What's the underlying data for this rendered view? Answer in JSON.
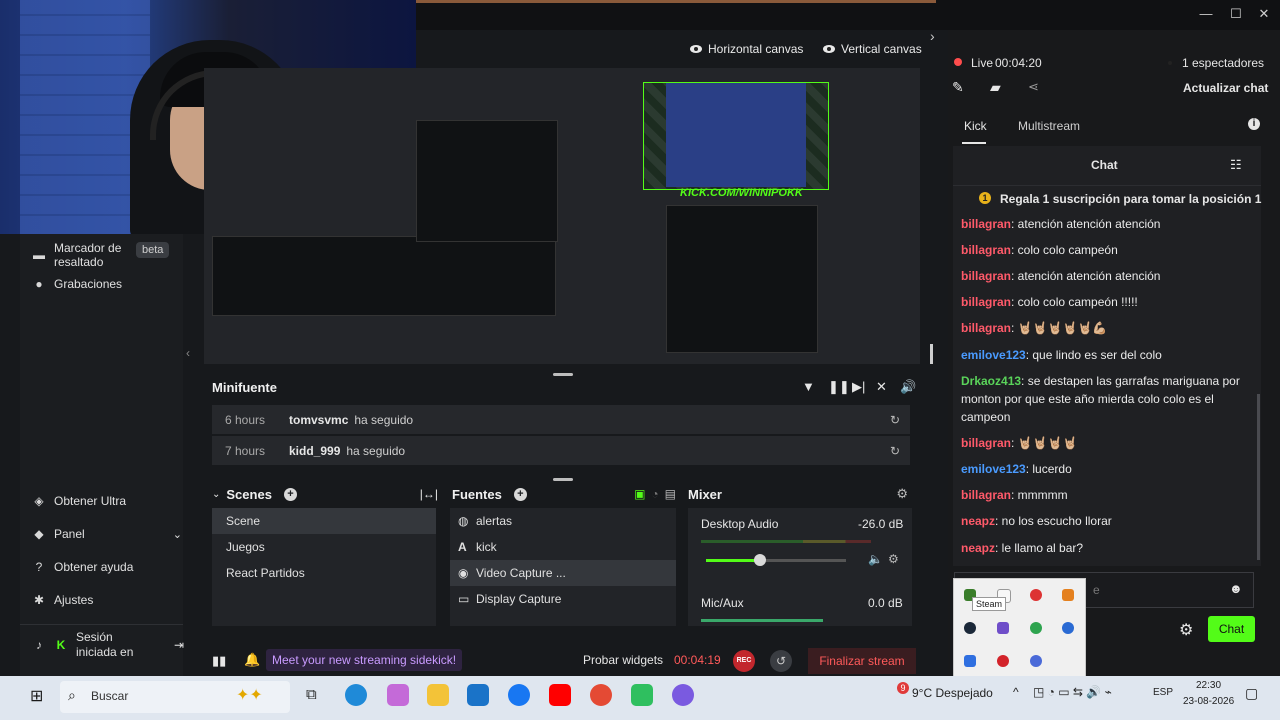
{
  "preview_toggles": {
    "horizontal": "Horizontal canvas",
    "vertical": "Vertical canvas"
  },
  "preview_overlay_text": "KICK.COM/WINNIPOKK",
  "sidebar": {
    "items": [
      {
        "label": "Marcador de resaltado",
        "badge": "beta",
        "icon": "highlight-icon"
      },
      {
        "label": "Grabaciones",
        "icon": "record-icon"
      },
      {
        "label": "Obtener Ultra",
        "icon": "ultra-icon"
      },
      {
        "label": "Panel",
        "icon": "panel-icon"
      },
      {
        "label": "Obtener ayuda",
        "icon": "help-icon"
      },
      {
        "label": "Ajustes",
        "icon": "settings-icon"
      }
    ],
    "session": "Sesión iniciada en"
  },
  "minifuente": {
    "title": "Minifuente",
    "events": [
      {
        "time": "6 hours",
        "user": "tomvsvmc",
        "action": "ha seguido"
      },
      {
        "time": "7 hours",
        "user": "kidd_999",
        "action": "ha seguido"
      }
    ]
  },
  "scenes": {
    "title": "Scenes",
    "items": [
      "Scene",
      "Juegos",
      "React Partidos"
    ],
    "selected": "Scene"
  },
  "fuentes": {
    "title": "Fuentes",
    "items": [
      {
        "label": "alertas",
        "icon": "globe-icon"
      },
      {
        "label": "kick",
        "icon": "text-icon"
      },
      {
        "label": "Video Capture ...",
        "icon": "camera-icon"
      },
      {
        "label": "Display Capture",
        "icon": "monitor-icon"
      }
    ]
  },
  "mixer": {
    "title": "Mixer",
    "channels": [
      {
        "name": "Desktop Audio",
        "level": "-26.0 dB"
      },
      {
        "name": "Mic/Aux",
        "level": "0.0 dB"
      }
    ]
  },
  "statusbar": {
    "promo": "Meet your new streaming sidekick!",
    "widgets": "Probar widgets",
    "timer": "00:04:19",
    "rec": "REC",
    "end": "Finalizar stream"
  },
  "chat": {
    "live_label": "Live",
    "live_time": "00:04:20",
    "viewers": "1 espectadores",
    "refresh": "Actualizar chat",
    "tabs": [
      "Kick",
      "Multistream"
    ],
    "title": "Chat",
    "pinned": "Regala 1 suscripción para tomar la posición 1",
    "messages": [
      {
        "user": "billagran",
        "text": ": atención atención atención",
        "color": "red"
      },
      {
        "user": "billagran",
        "text": ": colo colo campeón",
        "color": "red"
      },
      {
        "user": "billagran",
        "text": ": atención atención atención",
        "color": "red"
      },
      {
        "user": "billagran",
        "text": ": colo colo campeón !!!!!",
        "color": "red"
      },
      {
        "user": "billagran",
        "text": ": 🤘🏼🤘🏼🤘🏼🤘🏼🤘🏼💪🏼",
        "color": "red"
      },
      {
        "user": "emilove123",
        "text": ": que lindo es ser del colo",
        "color": "blue"
      },
      {
        "user": "Drkaoz413",
        "text": ": se destapen las garrafas mariguana por monton por que este año mierda colo colo es el campeon",
        "color": "green"
      },
      {
        "user": "billagran",
        "text": ": 🤘🏼🤘🏼🤘🏼🤘🏼",
        "color": "red"
      },
      {
        "user": "emilove123",
        "text": ": lucerdo",
        "color": "blue"
      },
      {
        "user": "billagran",
        "text": ": mmmmm",
        "color": "red"
      },
      {
        "user": "neapz",
        "text": ": no los escucho llorar",
        "color": "red"
      },
      {
        "user": "neapz",
        "text": ": le llamo al bar?",
        "color": "red"
      }
    ],
    "input_placeholder": "e",
    "send": "Chat"
  },
  "tray_popup": {
    "tooltip": "Steam"
  },
  "taskbar": {
    "search": "Buscar",
    "weather": "9°C Despejado",
    "weather_badge": "9",
    "lang": "ESP",
    "time": "22:30",
    "date": "23-08-2026"
  },
  "colors": {
    "accent_green": "#53fc18",
    "end_red": "#3a1d20",
    "live_red": "#ff4d4d"
  }
}
